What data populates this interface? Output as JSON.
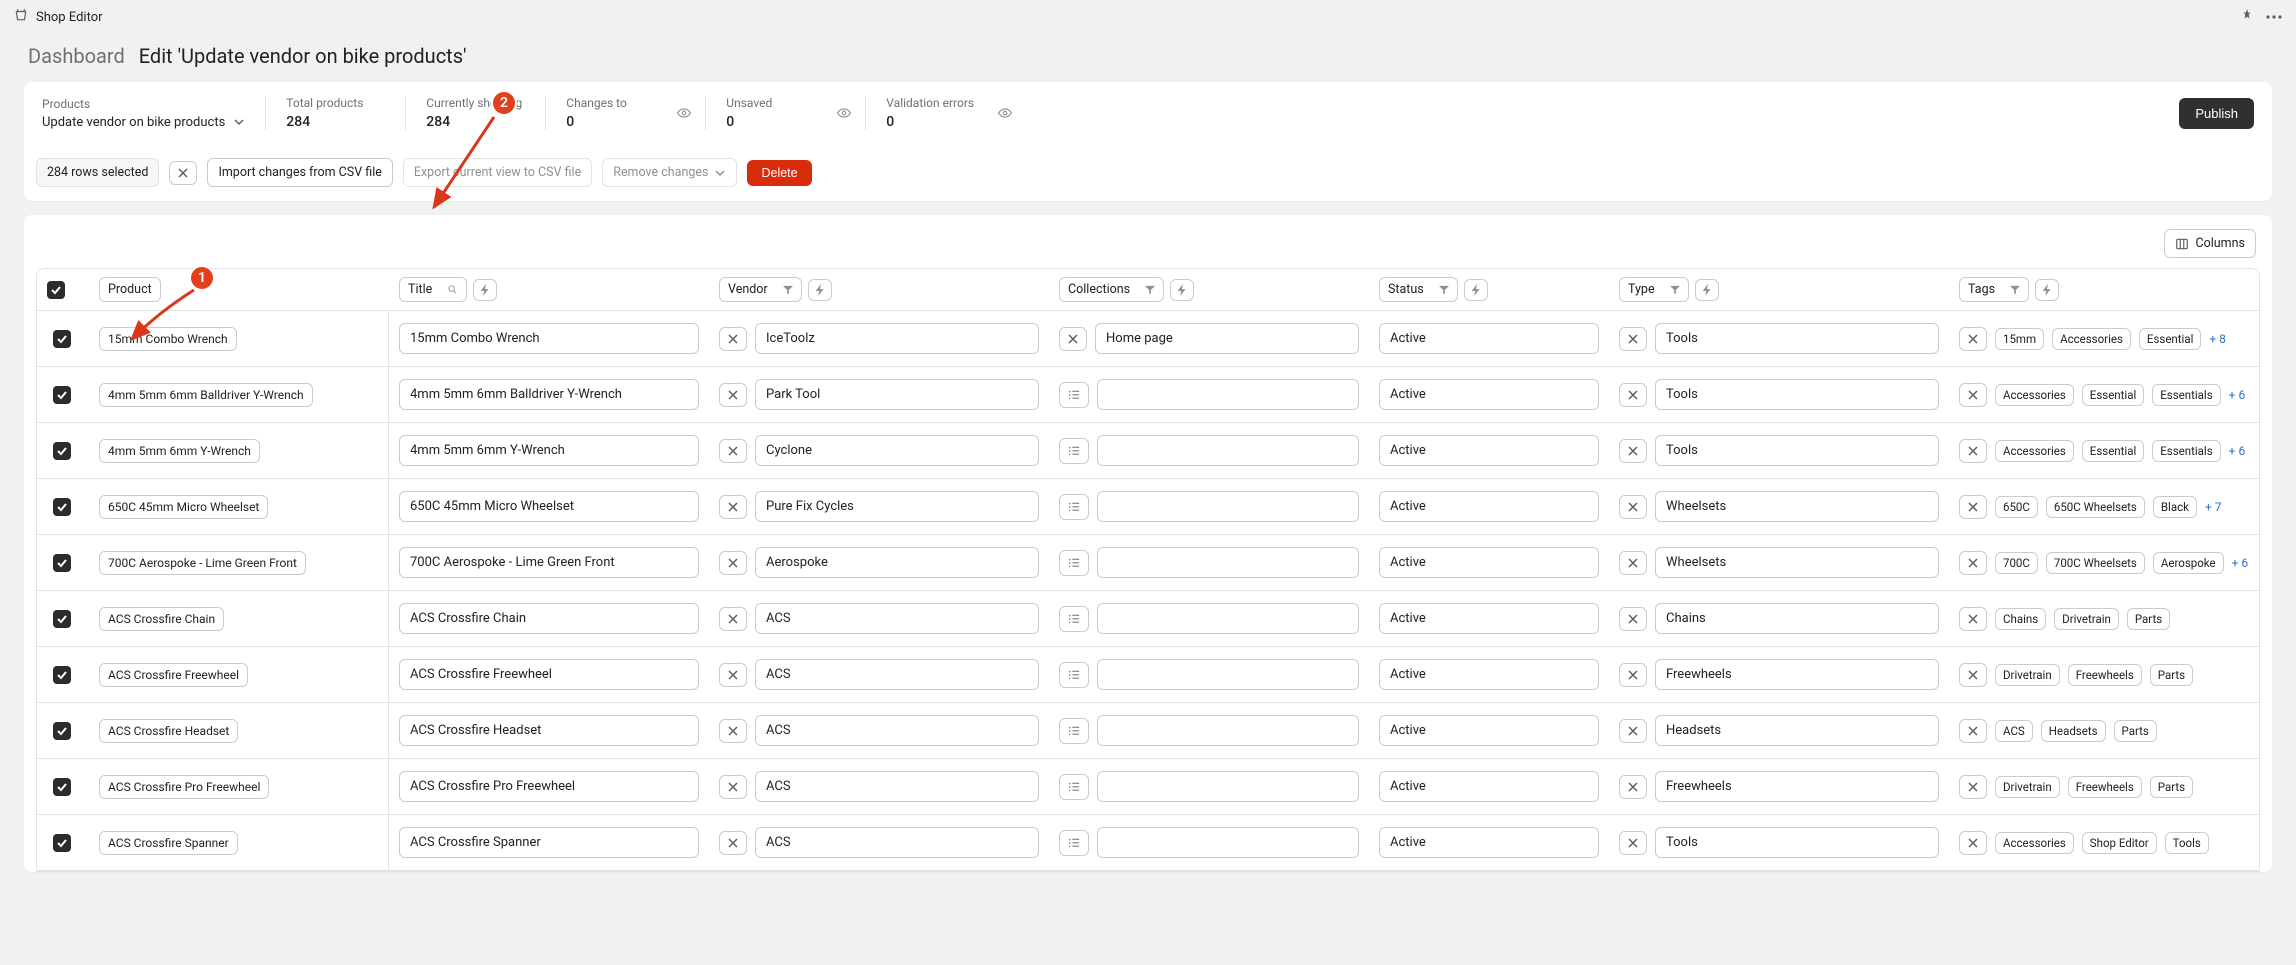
{
  "app": {
    "name": "Shop Editor"
  },
  "header": {
    "dashboard": "Dashboard",
    "title": "Edit 'Update vendor on bike products'"
  },
  "summary": {
    "products_label": "Products",
    "products_value": "Update vendor on bike products",
    "total_label": "Total products",
    "total_value": "284",
    "showing_label": "Currently showing",
    "showing_value": "284",
    "changes_label": "Changes to",
    "changes_value": "0",
    "unsaved_label": "Unsaved",
    "unsaved_value": "0",
    "errors_label": "Validation errors",
    "errors_value": "0",
    "publish": "Publish"
  },
  "toolbar": {
    "selected": "284 rows selected",
    "import": "Import changes from CSV file",
    "export": "Export current view to CSV file",
    "remove": "Remove changes",
    "delete": "Delete"
  },
  "table": {
    "columns_btn": "Columns",
    "headers": {
      "product": "Product",
      "title": "Title",
      "vendor": "Vendor",
      "collections": "Collections",
      "status": "Status",
      "type": "Type",
      "tags": "Tags"
    },
    "rows": [
      {
        "name": "15mm Combo Wrench",
        "title": "15mm Combo Wrench",
        "vendor": "IceToolz",
        "collections": [
          "Home page"
        ],
        "status": "Active",
        "type": "Tools",
        "tags": [
          "15mm",
          "Accessories",
          "Essential"
        ],
        "more": "+ 8"
      },
      {
        "name": "4mm 5mm 6mm Balldriver Y-Wrench",
        "title": "4mm 5mm 6mm Balldriver Y-Wrench",
        "vendor": "Park Tool",
        "collections": [],
        "status": "Active",
        "type": "Tools",
        "tags": [
          "Accessories",
          "Essential",
          "Essentials"
        ],
        "more": "+ 6"
      },
      {
        "name": "4mm 5mm 6mm Y-Wrench",
        "title": "4mm 5mm 6mm Y-Wrench",
        "vendor": "Cyclone",
        "collections": [],
        "status": "Active",
        "type": "Tools",
        "tags": [
          "Accessories",
          "Essential",
          "Essentials"
        ],
        "more": "+ 6"
      },
      {
        "name": "650C 45mm Micro Wheelset",
        "title": "650C 45mm Micro Wheelset",
        "vendor": "Pure Fix Cycles",
        "collections": [],
        "status": "Active",
        "type": "Wheelsets",
        "tags": [
          "650C",
          "650C Wheelsets",
          "Black"
        ],
        "more": "+ 7"
      },
      {
        "name": "700C Aerospoke - Lime Green Front",
        "title": "700C Aerospoke - Lime Green Front",
        "vendor": "Aerospoke",
        "collections": [],
        "status": "Active",
        "type": "Wheelsets",
        "tags": [
          "700C",
          "700C Wheelsets",
          "Aerospoke"
        ],
        "more": "+ 6"
      },
      {
        "name": "ACS Crossfire Chain",
        "title": "ACS Crossfire Chain",
        "vendor": "ACS",
        "collections": [],
        "status": "Active",
        "type": "Chains",
        "tags": [
          "Chains",
          "Drivetrain",
          "Parts"
        ],
        "more": ""
      },
      {
        "name": "ACS Crossfire Freewheel",
        "title": "ACS Crossfire Freewheel",
        "vendor": "ACS",
        "collections": [],
        "status": "Active",
        "type": "Freewheels",
        "tags": [
          "Drivetrain",
          "Freewheels",
          "Parts"
        ],
        "more": ""
      },
      {
        "name": "ACS Crossfire Headset",
        "title": "ACS Crossfire Headset",
        "vendor": "ACS",
        "collections": [],
        "status": "Active",
        "type": "Headsets",
        "tags": [
          "ACS",
          "Headsets",
          "Parts"
        ],
        "more": ""
      },
      {
        "name": "ACS Crossfire Pro Freewheel",
        "title": "ACS Crossfire Pro Freewheel",
        "vendor": "ACS",
        "collections": [],
        "status": "Active",
        "type": "Freewheels",
        "tags": [
          "Drivetrain",
          "Freewheels",
          "Parts"
        ],
        "more": ""
      },
      {
        "name": "ACS Crossfire Spanner",
        "title": "ACS Crossfire Spanner",
        "vendor": "ACS",
        "collections": [],
        "status": "Active",
        "type": "Tools",
        "tags": [
          "Accessories",
          "Shop Editor",
          "Tools"
        ],
        "more": ""
      }
    ]
  },
  "annotations": {
    "one": "1",
    "two": "2"
  }
}
